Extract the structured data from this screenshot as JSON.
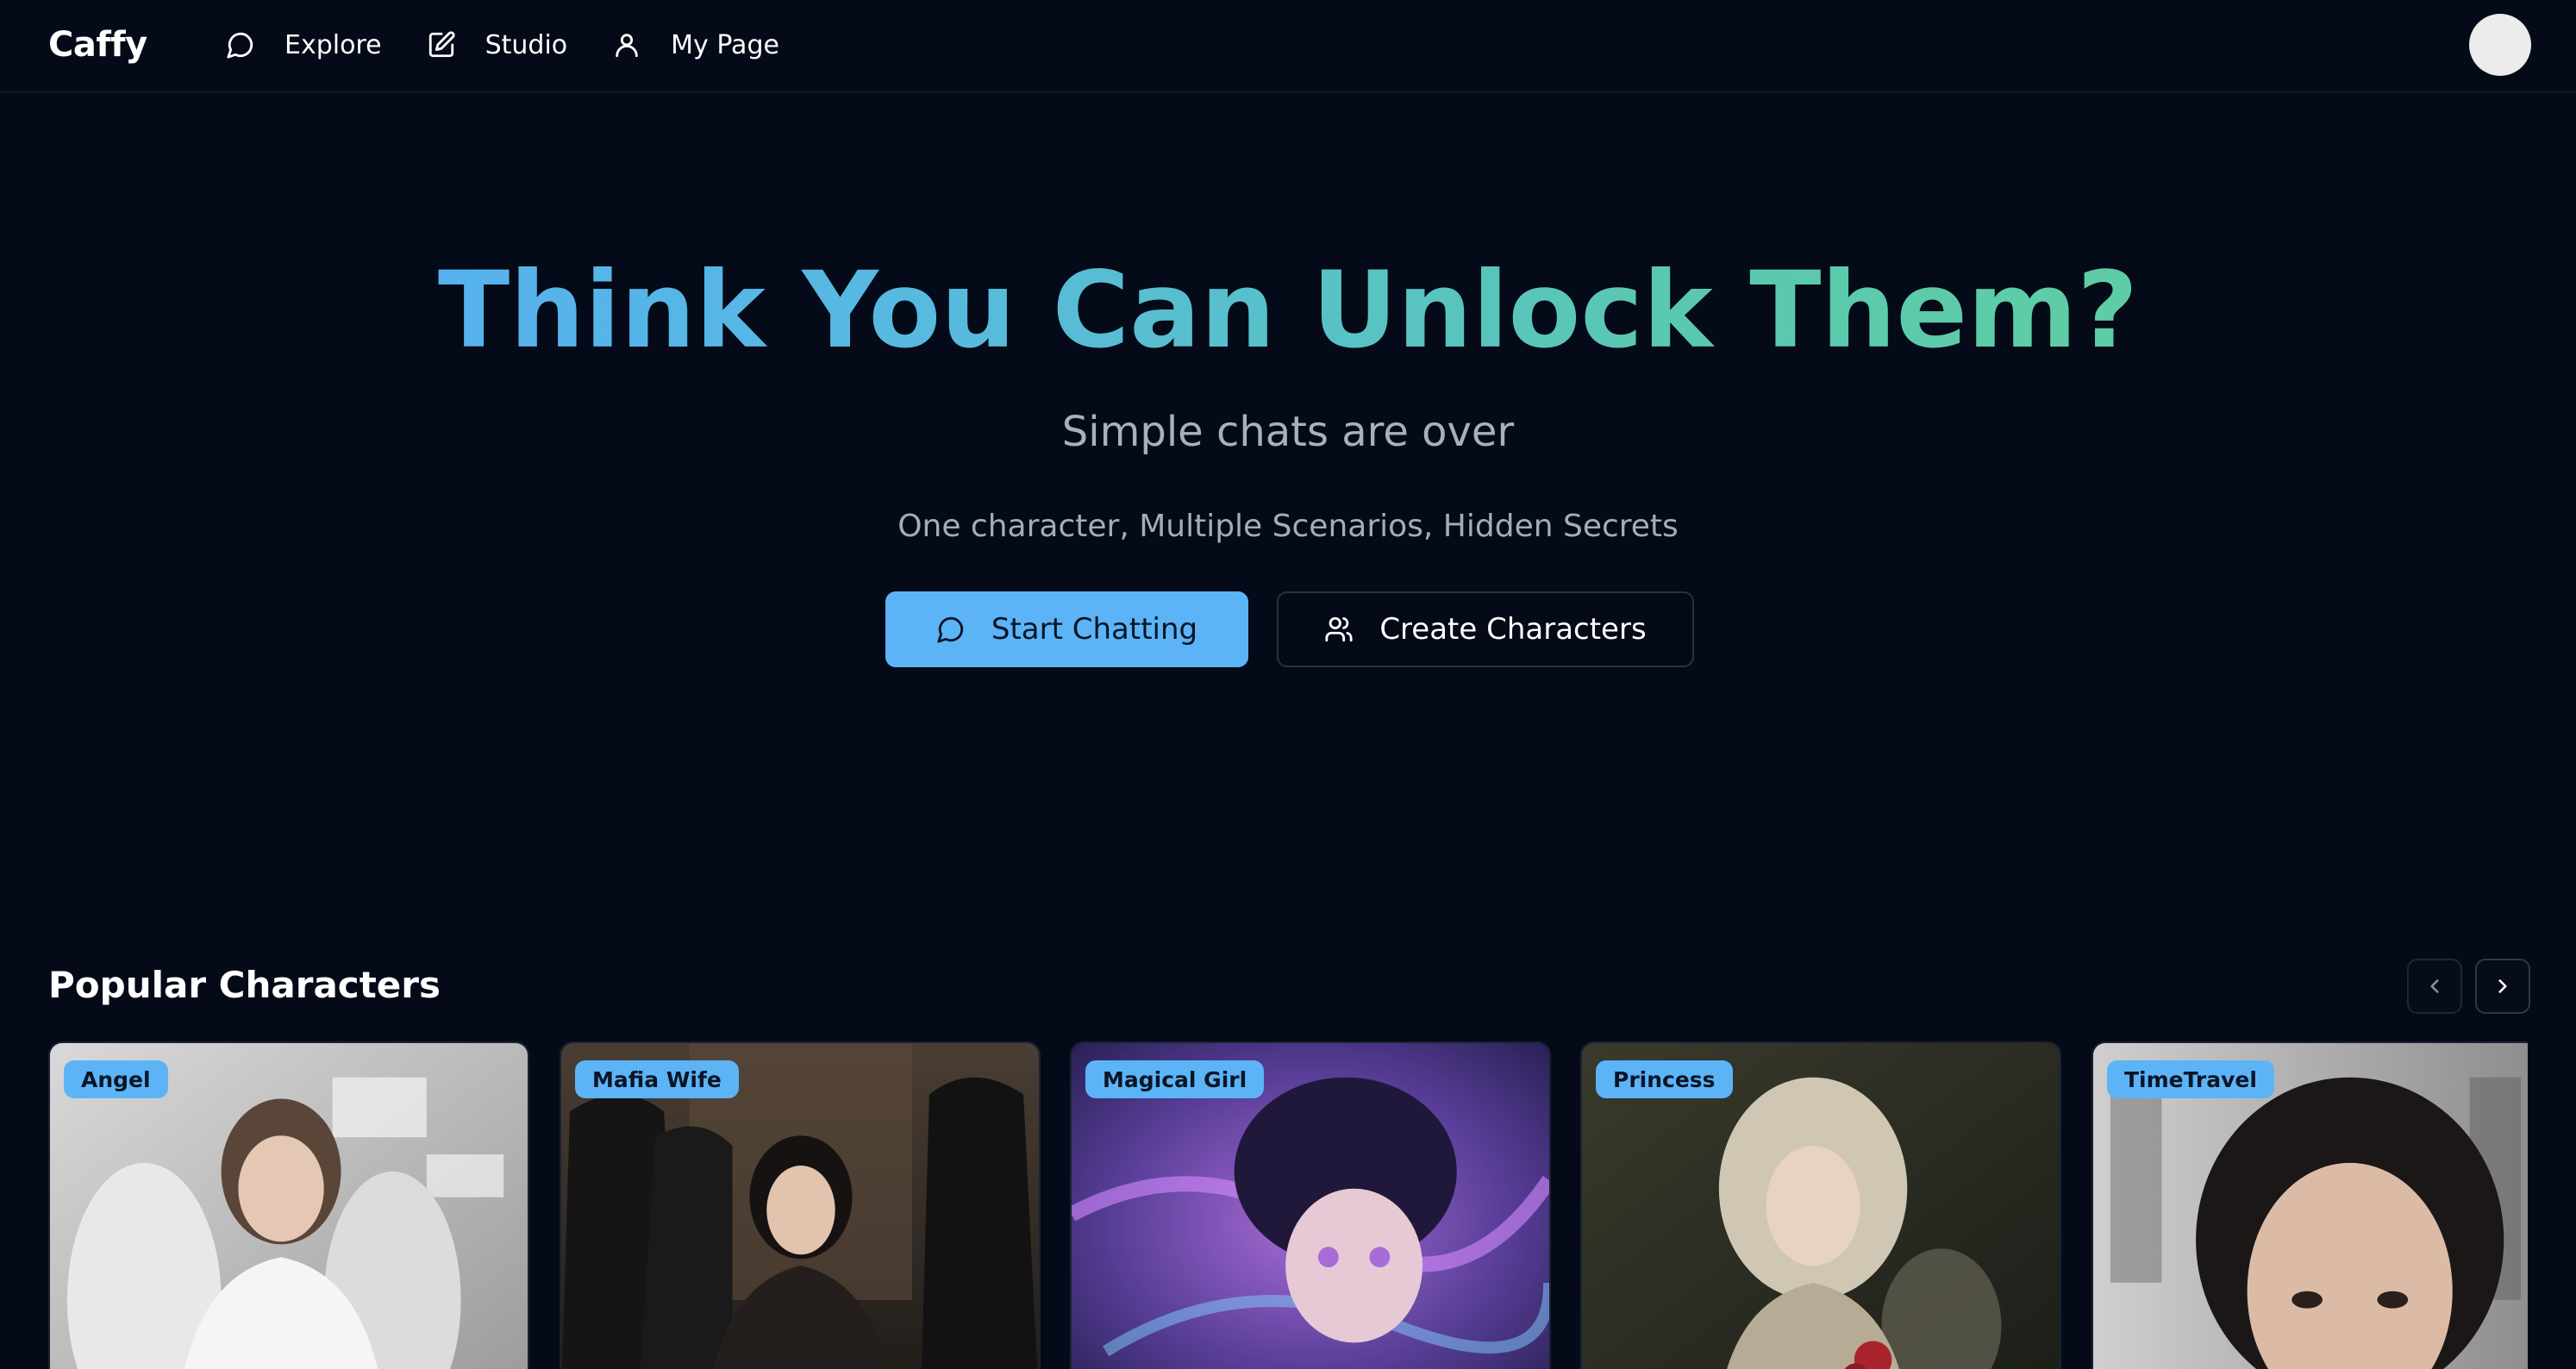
{
  "app": {
    "logo": "Caffy"
  },
  "nav": {
    "items": [
      {
        "label": "Explore",
        "icon": "chat-bubble-icon"
      },
      {
        "label": "Studio",
        "icon": "edit-icon"
      },
      {
        "label": "My Page",
        "icon": "user-icon"
      }
    ]
  },
  "hero": {
    "title": "Think You Can Unlock Them?",
    "subtitle": "Simple chats are over",
    "description": "One character, Multiple Scenarios, Hidden Secrets",
    "primary_button": "Start Chatting",
    "secondary_button": "Create Characters"
  },
  "popular": {
    "title": "Popular Characters",
    "cards": [
      {
        "tag": "Angel"
      },
      {
        "tag": "Mafia Wife"
      },
      {
        "tag": "Magical Girl"
      },
      {
        "tag": "Princess"
      },
      {
        "tag": "TimeTravel"
      }
    ]
  },
  "colors": {
    "background": "#040a17",
    "accent": "#5cb4f7",
    "gradient_start": "#55acfa",
    "gradient_end": "#63d29a"
  }
}
